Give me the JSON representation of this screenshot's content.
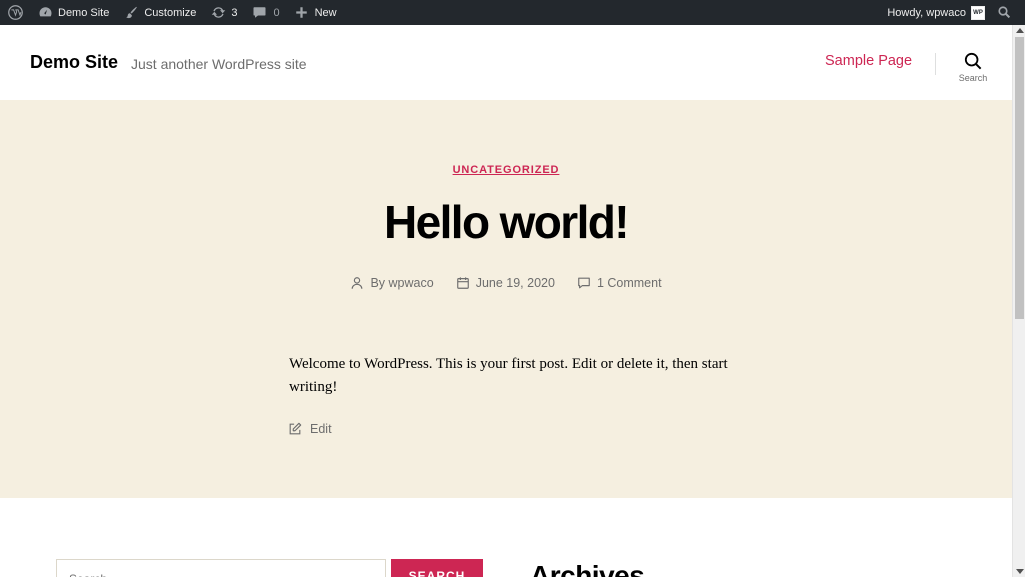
{
  "adminbar": {
    "site_name": "Demo Site",
    "customize": "Customize",
    "updates_count": "3",
    "comments_count": "0",
    "new_label": "New",
    "howdy": "Howdy, wpwaco",
    "avatar_text": "WP"
  },
  "header": {
    "site_title": "Demo Site",
    "site_description": "Just another WordPress site",
    "nav": [
      {
        "label": "Sample Page"
      }
    ],
    "search_label": "Search"
  },
  "post": {
    "category": "UNCATEGORIZED",
    "title": "Hello world!",
    "author": "By wpwaco",
    "date": "June 19, 2020",
    "comments": "1 Comment",
    "content": "Welcome to WordPress. This is your first post. Edit or delete it, then start writing!",
    "edit_label": "Edit"
  },
  "widgets": {
    "search_placeholder": "Search …",
    "search_button": "SEARCH",
    "archives_title": "Archives"
  },
  "colors": {
    "accent": "#cd2653",
    "hero_bg": "#f5efe0",
    "adminbar_bg": "#23282d"
  }
}
